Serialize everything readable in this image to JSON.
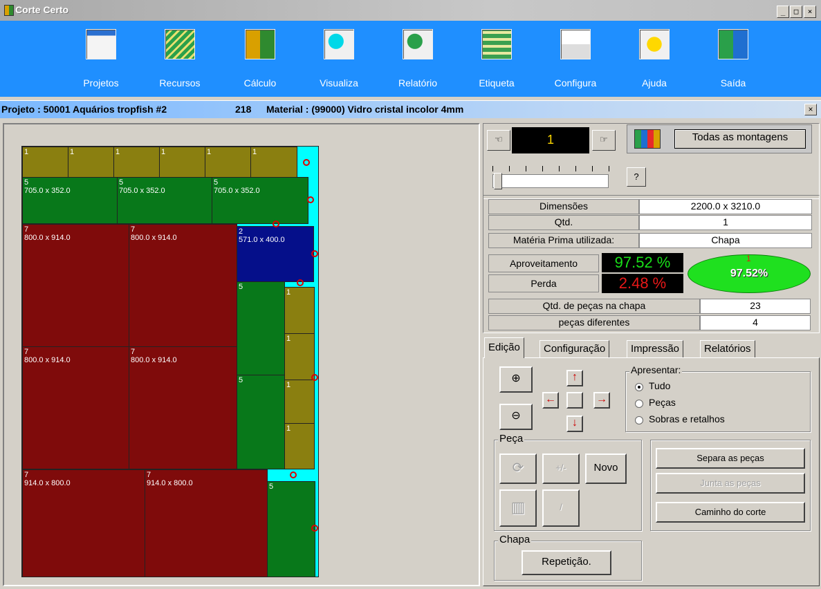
{
  "window": {
    "title": "Corte Certo",
    "min": "_",
    "max": "□",
    "close": "×"
  },
  "toolbar": {
    "items": [
      {
        "label": "Projetos"
      },
      {
        "label": "Recursos"
      },
      {
        "label": "Cálculo"
      },
      {
        "label": "Visualiza"
      },
      {
        "label": "Relatório"
      },
      {
        "label": "Etiqueta"
      },
      {
        "label": "Configura"
      },
      {
        "label": "Ajuda"
      },
      {
        "label": "Saída"
      }
    ]
  },
  "project_bar": {
    "projeto": "Projeto : 50001 Aquários tropfish #2",
    "number": "218",
    "material": "Material : (99000) Vidro cristal incolor 4mm",
    "close": "×"
  },
  "sheet": {
    "pieces": [
      {
        "id": "1",
        "dim": ""
      },
      {
        "id": "5",
        "dim": "705.0 x 352.0"
      },
      {
        "id": "7",
        "dim": "800.0 x 914.0"
      },
      {
        "id": "2",
        "dim": "571.0 x 400.0"
      },
      {
        "id": "7",
        "dim": "914.0 x 800.0"
      }
    ]
  },
  "nav": {
    "counter": "1",
    "all_button": "Todas as montagens",
    "help": "?"
  },
  "stats": {
    "dimensoes_label": "Dimensões",
    "dimensoes_value": "2200.0 x 3210.0",
    "qtd_label": "Qtd.",
    "qtd_value": "1",
    "materia_label": "Matéria Prima utilizada:",
    "materia_value": "Chapa",
    "aproveitamento_label": "Aproveitamento",
    "aproveitamento_value": "97.52 %",
    "perda_label": "Perda",
    "perda_value": "2.48 %",
    "pie_value": "97.52%",
    "pie_mark": "1",
    "pecas_label": "Qtd. de peças na chapa",
    "pecas_value": "23",
    "diferentes_label": "peças diferentes",
    "diferentes_value": "4"
  },
  "tabs": [
    "Edição",
    "Configuração",
    "Impressão",
    "Relatórios"
  ],
  "apresentar": {
    "label": "Apresentar:",
    "options": [
      "Tudo",
      "Peças",
      "Sobras e retalhos"
    ],
    "selected": "Tudo"
  },
  "peca": {
    "label": "Peça",
    "plusminus": "+/-",
    "novo": "Novo",
    "slash": "/"
  },
  "actions": {
    "separa": "Separa as peças",
    "junta": "Junta as peças",
    "caminho": "Caminho do corte"
  },
  "chapa": {
    "label": "Chapa",
    "repeticao": "Repetição."
  },
  "colors": {
    "toolbar": "#1f8fff",
    "olive": "#8a7f10",
    "green": "#08781a",
    "red": "#7f0b0b",
    "blue": "#050f8a",
    "offcut": "#00ffff"
  },
  "icons": [
    "calculator-icon",
    "stack-icon",
    "calc-doc-icon",
    "view-icon",
    "report-icon",
    "label-icon",
    "settings-icon",
    "help-icon",
    "exit-icon"
  ]
}
